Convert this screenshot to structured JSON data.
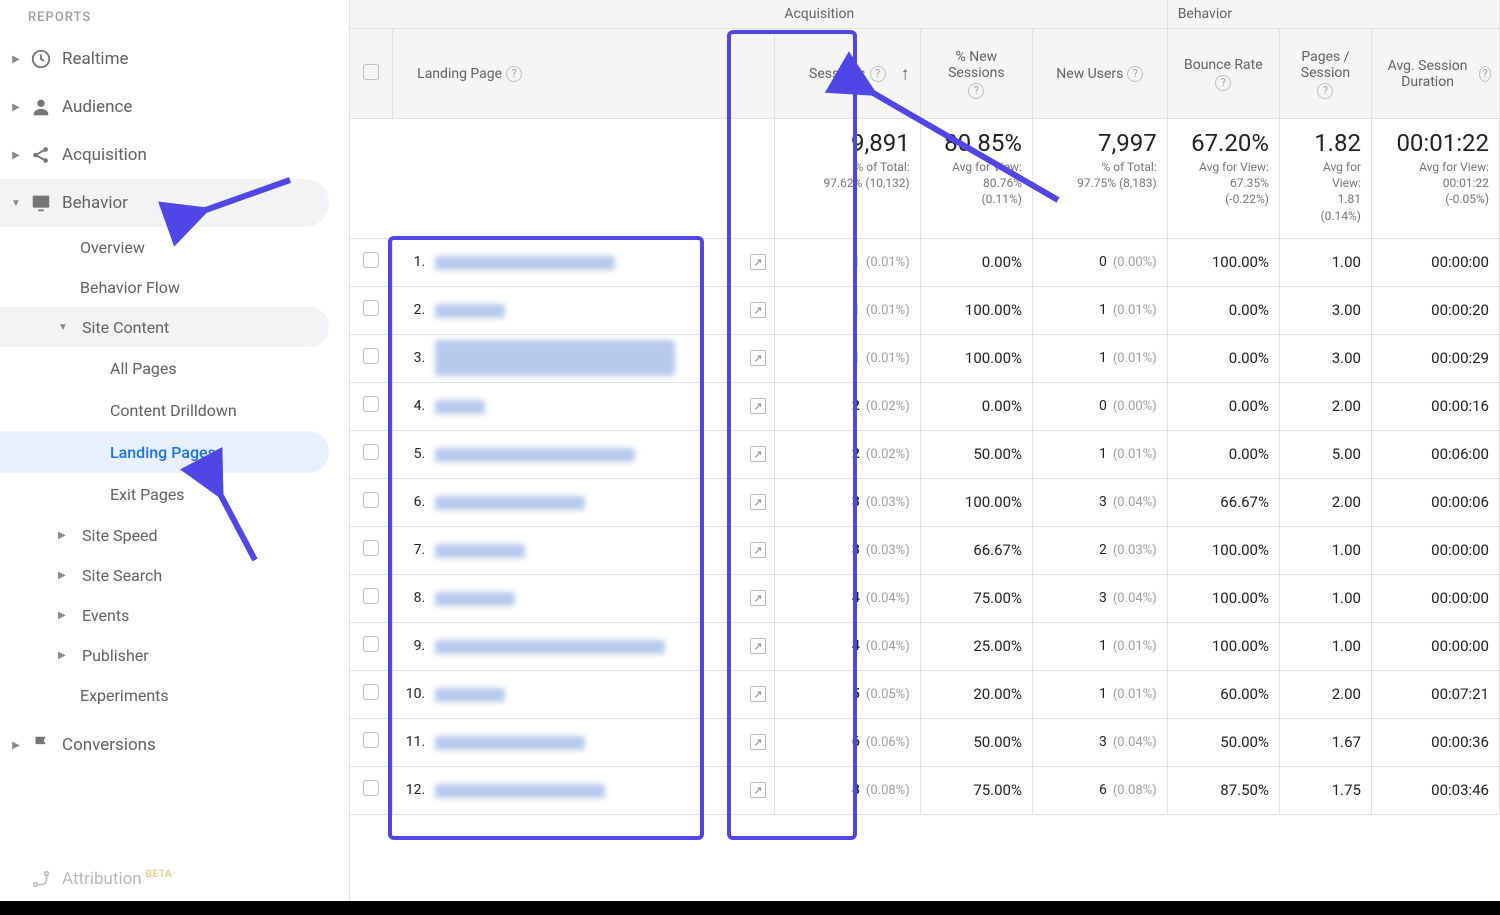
{
  "colors": {
    "accent": "#4f46e5",
    "link": "#1a73e8"
  },
  "sidebar": {
    "section_label": "REPORTS",
    "items": [
      {
        "id": "realtime",
        "label": "Realtime",
        "icon": "clock"
      },
      {
        "id": "audience",
        "label": "Audience",
        "icon": "person"
      },
      {
        "id": "acquisition",
        "label": "Acquisition",
        "icon": "share"
      },
      {
        "id": "behavior",
        "label": "Behavior",
        "icon": "screen",
        "open": true,
        "children": [
          {
            "id": "overview",
            "label": "Overview"
          },
          {
            "id": "behavior-flow",
            "label": "Behavior Flow"
          },
          {
            "id": "site-content",
            "label": "Site Content",
            "open": true,
            "children": [
              {
                "id": "all-pages",
                "label": "All Pages"
              },
              {
                "id": "content-drilldown",
                "label": "Content Drilldown"
              },
              {
                "id": "landing-pages",
                "label": "Landing Pages",
                "active": true
              },
              {
                "id": "exit-pages",
                "label": "Exit Pages"
              }
            ]
          },
          {
            "id": "site-speed",
            "label": "Site Speed"
          },
          {
            "id": "site-search",
            "label": "Site Search"
          },
          {
            "id": "events",
            "label": "Events"
          },
          {
            "id": "publisher",
            "label": "Publisher"
          },
          {
            "id": "experiments",
            "label": "Experiments"
          }
        ]
      },
      {
        "id": "conversions",
        "label": "Conversions",
        "icon": "flag"
      }
    ],
    "footer": {
      "label": "Attribution",
      "tag": "BETA",
      "icon": "path"
    }
  },
  "table": {
    "groups": {
      "acquisition": "Acquisition",
      "behavior": "Behavior"
    },
    "columns": {
      "landing_page": "Landing Page",
      "sessions": "Sessions",
      "pct_new_sessions": "% New Sessions",
      "new_users": "New Users",
      "bounce_rate": "Bounce Rate",
      "pages_per_session": "Pages / Session",
      "avg_session_duration": "Avg. Session Duration"
    },
    "sort": {
      "column": "sessions",
      "dir": "asc"
    },
    "summary": {
      "sessions": {
        "value": "9,891",
        "sub1": "% of Total:",
        "sub2": "97.62% (10,132)"
      },
      "pct_new_sessions": {
        "value": "80.85%",
        "sub1": "Avg for View:",
        "sub2": "80.76%",
        "sub3": "(0.11%)"
      },
      "new_users": {
        "value": "7,997",
        "sub1": "% of Total:",
        "sub2": "97.75% (8,183)"
      },
      "bounce_rate": {
        "value": "67.20%",
        "sub1": "Avg for View:",
        "sub2": "67.35%",
        "sub3": "(-0.22%)"
      },
      "pages_per_session": {
        "value": "1.82",
        "sub1": "Avg for",
        "sub2": "View:",
        "sub3": "1.81",
        "sub4": "(0.14%)"
      },
      "avg_session_duration": {
        "value": "00:01:22",
        "sub1": "Avg for View:",
        "sub2": "00:01:22",
        "sub3": "(-0.05%)"
      }
    },
    "rows": [
      {
        "n": "1.",
        "blurw": 180,
        "sessions": "1",
        "sessions_pct": "(0.01%)",
        "pct_new": "0.00%",
        "new_users": "0",
        "new_users_pct": "(0.00%)",
        "bounce": "100.00%",
        "pps": "1.00",
        "dur": "00:00:00"
      },
      {
        "n": "2.",
        "blurw": 70,
        "sessions": "1",
        "sessions_pct": "(0.01%)",
        "pct_new": "100.00%",
        "new_users": "1",
        "new_users_pct": "(0.01%)",
        "bounce": "0.00%",
        "pps": "3.00",
        "dur": "00:00:20"
      },
      {
        "n": "3.",
        "blurw": 240,
        "blurh": 36,
        "sessions": "1",
        "sessions_pct": "(0.01%)",
        "pct_new": "100.00%",
        "new_users": "1",
        "new_users_pct": "(0.01%)",
        "bounce": "0.00%",
        "pps": "3.00",
        "dur": "00:00:29"
      },
      {
        "n": "4.",
        "blurw": 50,
        "sessions": "2",
        "sessions_pct": "(0.02%)",
        "pct_new": "0.00%",
        "new_users": "0",
        "new_users_pct": "(0.00%)",
        "bounce": "0.00%",
        "pps": "2.00",
        "dur": "00:00:16"
      },
      {
        "n": "5.",
        "blurw": 200,
        "sessions": "2",
        "sessions_pct": "(0.02%)",
        "pct_new": "50.00%",
        "new_users": "1",
        "new_users_pct": "(0.01%)",
        "bounce": "0.00%",
        "pps": "5.00",
        "dur": "00:06:00"
      },
      {
        "n": "6.",
        "blurw": 150,
        "sessions": "3",
        "sessions_pct": "(0.03%)",
        "pct_new": "100.00%",
        "new_users": "3",
        "new_users_pct": "(0.04%)",
        "bounce": "66.67%",
        "pps": "2.00",
        "dur": "00:00:06"
      },
      {
        "n": "7.",
        "blurw": 90,
        "sessions": "3",
        "sessions_pct": "(0.03%)",
        "pct_new": "66.67%",
        "new_users": "2",
        "new_users_pct": "(0.03%)",
        "bounce": "100.00%",
        "pps": "1.00",
        "dur": "00:00:00"
      },
      {
        "n": "8.",
        "blurw": 80,
        "sessions": "4",
        "sessions_pct": "(0.04%)",
        "pct_new": "75.00%",
        "new_users": "3",
        "new_users_pct": "(0.04%)",
        "bounce": "100.00%",
        "pps": "1.00",
        "dur": "00:00:00"
      },
      {
        "n": "9.",
        "blurw": 230,
        "sessions": "4",
        "sessions_pct": "(0.04%)",
        "pct_new": "25.00%",
        "new_users": "1",
        "new_users_pct": "(0.01%)",
        "bounce": "100.00%",
        "pps": "1.00",
        "dur": "00:00:00"
      },
      {
        "n": "10.",
        "blurw": 70,
        "sessions": "5",
        "sessions_pct": "(0.05%)",
        "pct_new": "20.00%",
        "new_users": "1",
        "new_users_pct": "(0.01%)",
        "bounce": "60.00%",
        "pps": "2.00",
        "dur": "00:07:21"
      },
      {
        "n": "11.",
        "blurw": 150,
        "sessions": "6",
        "sessions_pct": "(0.06%)",
        "pct_new": "50.00%",
        "new_users": "3",
        "new_users_pct": "(0.04%)",
        "bounce": "50.00%",
        "pps": "1.67",
        "dur": "00:00:36"
      },
      {
        "n": "12.",
        "blurw": 170,
        "sessions": "8",
        "sessions_pct": "(0.08%)",
        "pct_new": "75.00%",
        "new_users": "6",
        "new_users_pct": "(0.08%)",
        "bounce": "87.50%",
        "pps": "1.75",
        "dur": "00:03:46"
      }
    ]
  }
}
